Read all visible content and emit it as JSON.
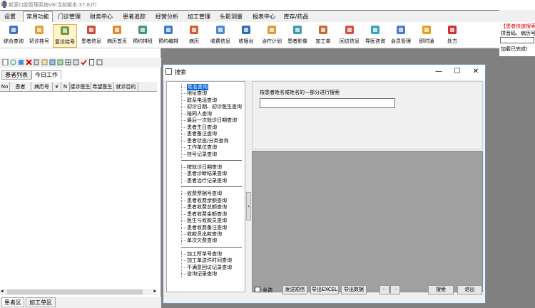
{
  "window": {
    "title": "新源口腔管理系统V8(当前版本:37.82f)"
  },
  "menu": {
    "items": [
      "设置",
      "常用功能",
      "门诊管理",
      "财务中心",
      "患者追踪",
      "经营分析",
      "加工管理",
      "头影测量",
      "报表中心",
      "库存/药品"
    ],
    "active_index": 1
  },
  "toolbar": {
    "items": [
      {
        "label": "综合查询",
        "icon": "magnifier-icon"
      },
      {
        "label": "初诊挂号",
        "icon": "first-visit-icon"
      },
      {
        "label": "复诊挂号",
        "icon": "revisit-icon"
      },
      {
        "label": "患者信息",
        "icon": "patient-info-icon"
      },
      {
        "label": "病历首页",
        "icon": "record-home-icon"
      },
      {
        "label": "预约排班",
        "icon": "schedule-icon"
      },
      {
        "label": "预约编排",
        "icon": "appointment-icon"
      },
      {
        "label": "病历",
        "icon": "medical-record-icon"
      },
      {
        "label": "收费信息",
        "icon": "fee-info-icon"
      },
      {
        "label": "收银台",
        "icon": "cashier-icon"
      },
      {
        "label": "治疗计划",
        "icon": "treatment-plan-icon"
      },
      {
        "label": "患者影像",
        "icon": "patient-image-icon"
      },
      {
        "label": "加工单",
        "icon": "process-order-icon"
      },
      {
        "label": "回访信息",
        "icon": "followup-icon"
      },
      {
        "label": "导医咨询",
        "icon": "consult-icon"
      },
      {
        "label": "会员管理",
        "icon": "member-icon"
      },
      {
        "label": "即时通",
        "icon": "messenger-icon"
      },
      {
        "label": "处方",
        "icon": "prescription-icon"
      }
    ],
    "active_index": 2
  },
  "quick_search": {
    "title": "【患者快速搜索】",
    "hint": "拼音码、病历号",
    "status": "加载已完成!"
  },
  "left_panel": {
    "tabs": [
      "患者列表",
      "今日工作"
    ],
    "active_tab": 1,
    "columns": [
      "No",
      "患者",
      "病历号",
      "¥",
      "N",
      "接诊医生",
      "希望医生",
      "就诊目的"
    ]
  },
  "bottom_tabs": [
    "患者区",
    "加工单区"
  ],
  "dialog": {
    "title": "搜索",
    "minimize": "—",
    "maximize": "☐",
    "close": "✕",
    "tree_groups": [
      [
        "姓名查询",
        "地址查询",
        "联系电话查询",
        "初诊日期、初诊医生查询",
        "陪同人查询",
        "最后一次就诊日期查询",
        "患者生日查询",
        "患者备注查询",
        "患者状态/分类查询",
        "工作单位查询",
        "挂号记录查询"
      ],
      [
        "按就诊日期查询",
        "患者诊断结果查询",
        "患者治疗记录查询"
      ],
      [
        "收费票据号查询",
        "患者收费余额查询",
        "患者收费总额查询",
        "患者收费金额查询",
        "医生与收款员查询",
        "患者收费备注查询",
        "收款员出款查询",
        "单次欠费查询"
      ],
      [
        "加工所单号查询",
        "加工单送件时间查询",
        "不满意回访记录查询",
        "咨询记录查询"
      ]
    ],
    "search_label": "按患者姓名或姓名的一部分进行搜索",
    "search_value": "",
    "select_all": "全选",
    "buttons": {
      "send_sms": "发送短信",
      "export_excel": "导出EXCEL",
      "export_data": "导出数据",
      "prev": "←",
      "next": "→",
      "search": "搜索",
      "exit": "退出"
    }
  }
}
